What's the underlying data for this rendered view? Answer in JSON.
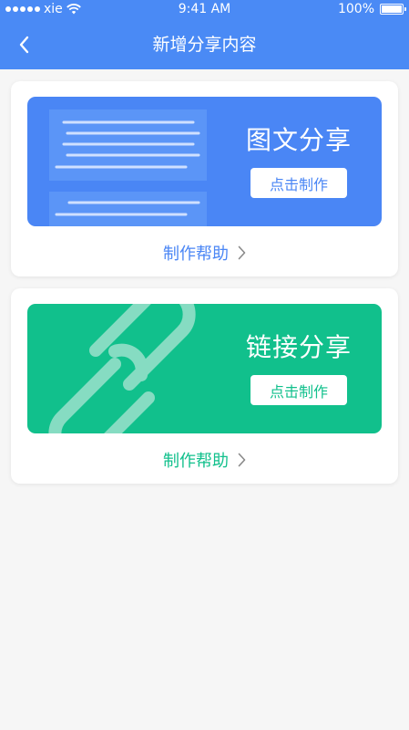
{
  "status_bar": {
    "carrier": "xie",
    "time": "9:41 AM",
    "battery": "100%",
    "battery_level": 1.0
  },
  "nav": {
    "title": "新增分享内容"
  },
  "cards": [
    {
      "title": "图文分享",
      "button": "点击制作",
      "help": "制作帮助",
      "color": "#4a86f5"
    },
    {
      "title": "链接分享",
      "button": "点击制作",
      "help": "制作帮助",
      "color": "#11c08c"
    }
  ],
  "icons": {
    "back": "chevron-left-icon",
    "help_arrow": "chevron-right-icon",
    "wifi": "wifi-icon",
    "battery": "battery-icon"
  }
}
